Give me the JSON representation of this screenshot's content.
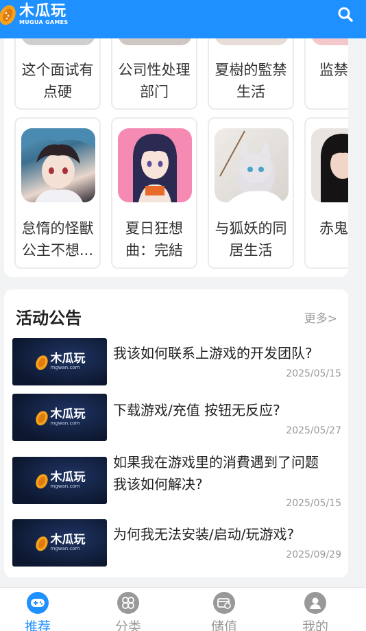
{
  "header": {
    "logo_cn": "木瓜玩",
    "logo_en": "MUGUA GAMES"
  },
  "games_row1": [
    {
      "title_line1": "这个面试有",
      "title_line2": "点硬"
    },
    {
      "title_line1": "公司性处理",
      "title_line2": "部门"
    },
    {
      "title_line1": "夏樹的監禁",
      "title_line2": "生活"
    },
    {
      "title_line1": "监禁",
      "title_line2": ""
    }
  ],
  "games_row2": [
    {
      "title_line1": "怠惰的怪獸",
      "title_line2": "公主不想..."
    },
    {
      "title_line1": "夏日狂想",
      "title_line2": "曲：完結"
    },
    {
      "title_line1": "与狐妖的同",
      "title_line2": "居生活"
    },
    {
      "title_line1": "赤鬼",
      "title_line2": ""
    }
  ],
  "notices": {
    "title": "活动公告",
    "more": "更多>",
    "thumb_cn": "木瓜玩",
    "thumb_en": "mgwan.com",
    "items": [
      {
        "line1": "我该如何联系上游戏的开发团队?",
        "line2": "",
        "date": "2025/05/15"
      },
      {
        "line1": "下载游戏/充值 按钮无反应?",
        "line2": "",
        "date": "2025/05/27"
      },
      {
        "line1": "如果我在游戏里的消費遇到了问题",
        "line2": "我该如何解决?",
        "date": "2025/05/15"
      },
      {
        "line1": "为何我无法安装/启动/玩游戏?",
        "line2": "",
        "date": "2025/09/29"
      }
    ]
  },
  "nav": {
    "items": [
      {
        "label": "推荐",
        "icon": "gamepad-icon",
        "active": true
      },
      {
        "label": "分类",
        "icon": "category-icon",
        "active": false
      },
      {
        "label": "储值",
        "icon": "wallet-icon",
        "active": false
      },
      {
        "label": "我的",
        "icon": "user-icon",
        "active": false
      }
    ],
    "active_color": "#1e90ff",
    "inactive_color": "#999999"
  },
  "colors": {
    "brand": "#1e90ff",
    "logo_orange": "#f7a21b"
  }
}
